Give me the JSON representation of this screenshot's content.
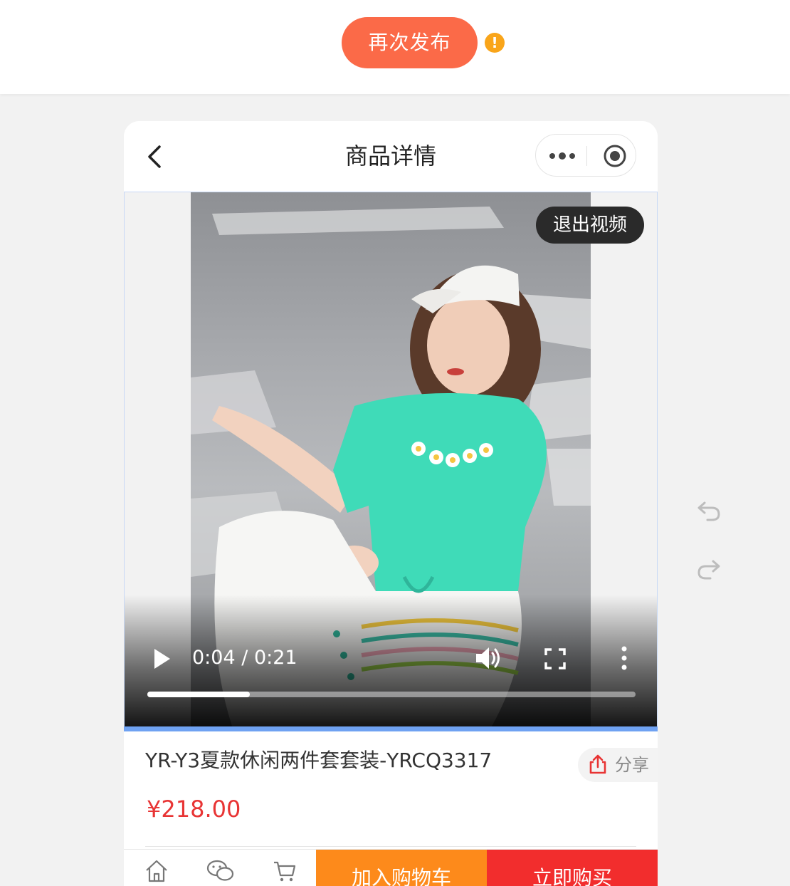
{
  "topbar": {
    "republish_label": "再次发布",
    "warning": "!"
  },
  "navbar": {
    "title": "商品详情"
  },
  "video": {
    "exit_label": "退出视频",
    "current_time": "0:04",
    "duration": "0:21",
    "time_separator": "/",
    "progress": 0.21
  },
  "product": {
    "title": "YR-Y3夏款休闲两件套套装-YRCQ3317",
    "share_label": "分享",
    "price": "¥218.00"
  },
  "bottom_bar": {
    "add_to_cart": "加入购物车",
    "buy_now": "立即购买"
  },
  "colors": {
    "accent": "#fb6a48",
    "warning": "#f9a51a",
    "price": "#e83434",
    "cart": "#fd8a1b",
    "buy": "#f22d2d",
    "progress_line": "#6fa2f2"
  }
}
